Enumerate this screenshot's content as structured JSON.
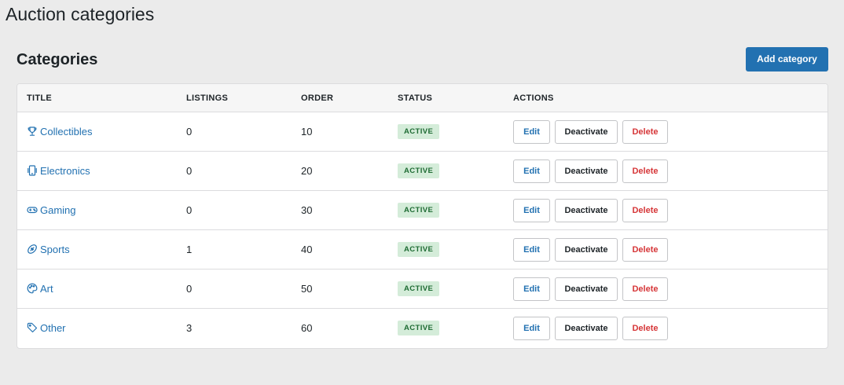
{
  "page": {
    "title": "Auction categories"
  },
  "section": {
    "title": "Categories",
    "add_button_label": "Add category"
  },
  "table": {
    "columns": [
      "TITLE",
      "LISTINGS",
      "ORDER",
      "STATUS",
      "ACTIONS"
    ],
    "actions": {
      "edit": "Edit",
      "deactivate": "Deactivate",
      "delete": "Delete"
    },
    "rows": [
      {
        "title": "Collectibles",
        "icon": "trophy-icon",
        "listings": "0",
        "order": "10",
        "status": "ACTIVE"
      },
      {
        "title": "Electronics",
        "icon": "phone-icon",
        "listings": "0",
        "order": "20",
        "status": "ACTIVE"
      },
      {
        "title": "Gaming",
        "icon": "gamepad-icon",
        "listings": "0",
        "order": "30",
        "status": "ACTIVE"
      },
      {
        "title": "Sports",
        "icon": "football-icon",
        "listings": "1",
        "order": "40",
        "status": "ACTIVE"
      },
      {
        "title": "Art",
        "icon": "palette-icon",
        "listings": "0",
        "order": "50",
        "status": "ACTIVE"
      },
      {
        "title": "Other",
        "icon": "tag-icon",
        "listings": "3",
        "order": "60",
        "status": "ACTIVE"
      }
    ]
  },
  "colors": {
    "primary": "#2271b1",
    "danger": "#d63638",
    "badge_bg": "#d4ecd9",
    "badge_text": "#1e6b33"
  }
}
